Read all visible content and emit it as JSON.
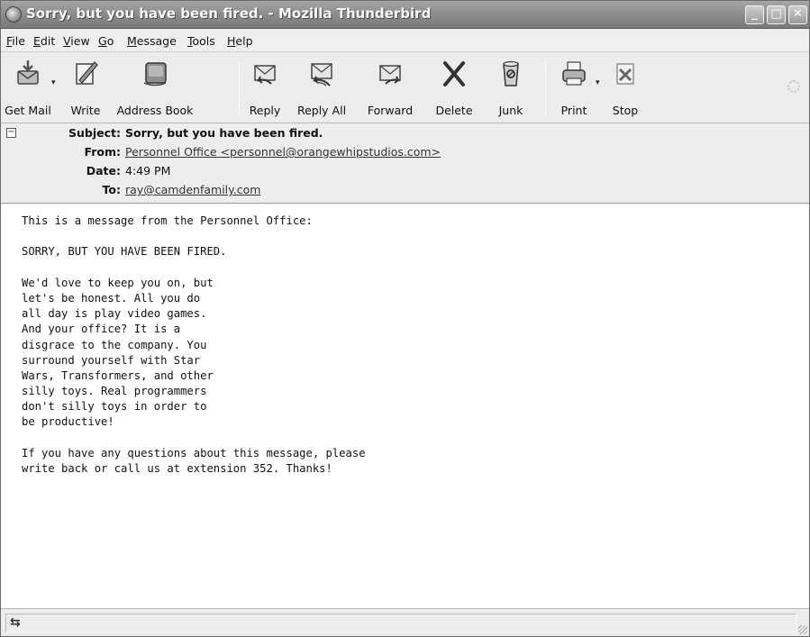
{
  "window": {
    "title": "Sorry, but you have been fired. - Mozilla Thunderbird",
    "controls": {
      "minimize": "_",
      "maximize": "□",
      "close": "✕"
    }
  },
  "menubar": {
    "items": [
      {
        "label_u": "F",
        "label_rest": "ile"
      },
      {
        "label_u": "E",
        "label_rest": "dit"
      },
      {
        "label_u": "V",
        "label_rest": "iew"
      },
      {
        "label_u": "G",
        "label_rest": "o"
      },
      {
        "label_u": "M",
        "label_rest": "essage"
      },
      {
        "label_u": "T",
        "label_rest": "ools"
      },
      {
        "label_u": "H",
        "label_rest": "elp"
      }
    ]
  },
  "toolbar": {
    "buttons": [
      {
        "label": "Get Mail",
        "icon": "get-mail-icon"
      },
      {
        "label": "Write",
        "icon": "write-icon"
      },
      {
        "label": "Address Book",
        "icon": "address-book-icon"
      },
      {
        "label": "Reply",
        "icon": "reply-icon"
      },
      {
        "label": "Reply All",
        "icon": "reply-all-icon"
      },
      {
        "label": "Forward",
        "icon": "forward-icon"
      },
      {
        "label": "Delete",
        "icon": "delete-icon"
      },
      {
        "label": "Junk",
        "icon": "junk-icon"
      },
      {
        "label": "Print",
        "icon": "print-icon"
      },
      {
        "label": "Stop",
        "icon": "stop-icon"
      }
    ]
  },
  "headers": {
    "subject_label": "Subject:",
    "subject": "Sorry, but you have been fired.",
    "from_label": "From:",
    "from": "Personnel Office <personnel@orangewhipstudios.com>",
    "date_label": "Date:",
    "date": "4:49 PM",
    "to_label": "To:",
    "to": "ray@camdenfamily.com"
  },
  "message": {
    "lines": [
      "This is a message from the Personnel Office:",
      "",
      "SORRY, BUT YOU HAVE BEEN FIRED.",
      "",
      "We'd love to keep you on, but",
      "let's be honest. All you do",
      "all day is play video games.",
      "And your office? It is a",
      "disgrace to the company. You",
      "surround yourself with Star",
      "Wars, Transformers, and other",
      "silly toys. Real programmers",
      "don't silly toys in order to",
      "be productive!",
      "",
      "If you have any questions about this message, please",
      "write back or call us at extension 352. Thanks!"
    ]
  },
  "statusbar": {
    "icon": "offline-status-icon",
    "text": ""
  },
  "colors": {
    "titlebar": "#8e8e8e",
    "chrome": "#ececec",
    "body": "#ffffff"
  }
}
